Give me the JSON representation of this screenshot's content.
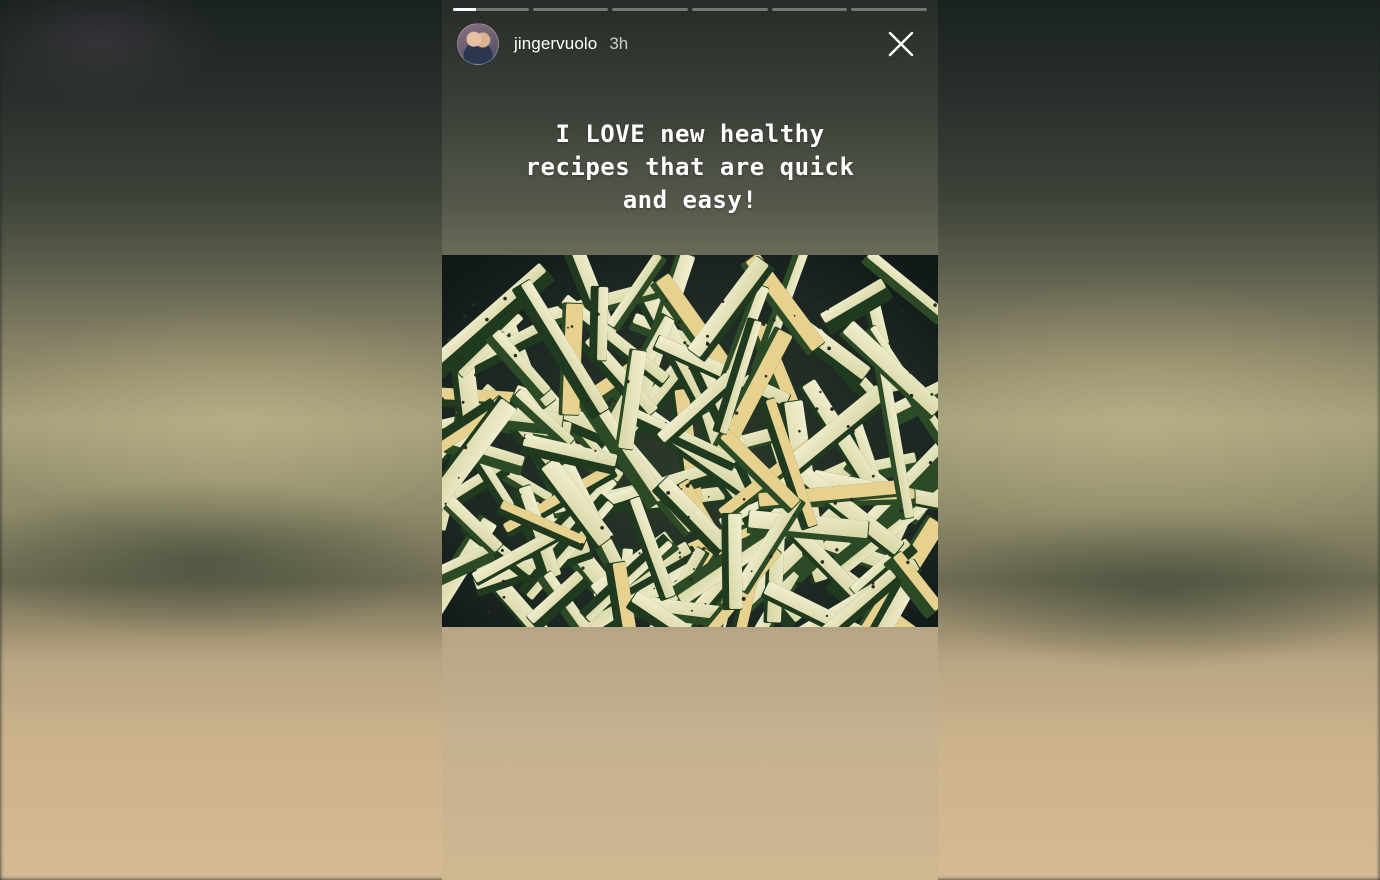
{
  "story": {
    "progress_segments": 6,
    "active_segment": 0,
    "active_segment_progress": 0.3,
    "username": "jingervuolo",
    "time_ago": "3h",
    "caption": "I LOVE new healthy recipes that are quick and easy!",
    "photo_subject": "sauteed zucchini sticks in a pan"
  },
  "icons": {
    "close": "close-icon",
    "avatar": "profile-avatar"
  },
  "colors": {
    "progress_active": "#ffffff",
    "progress_inactive": "rgba(255,255,255,0.35)"
  }
}
